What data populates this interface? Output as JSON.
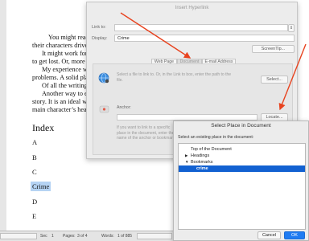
{
  "document": {
    "paragraphs": [
      "You might read th",
      "their characters drive",
      "It might work for",
      "to get lost. Or, more p",
      "My experience wa",
      "problems. A solid plan",
      "Of all the writing t",
      "Another way to ex",
      "story. It is an ideal wa",
      "main character’s head"
    ],
    "index_heading": "Index",
    "index_letters": [
      "A",
      "B",
      "C",
      "Crime",
      "D",
      "E"
    ]
  },
  "status_bar": {
    "section_label": "Sec",
    "section_value": "1",
    "pages_label": "Pages:",
    "pages_value": "3 of 4",
    "words_label": "Words:",
    "words_value": "1 of 885"
  },
  "hyperlink_dialog": {
    "title": "Insert Hyperlink",
    "link_to_label": "Link to:",
    "link_to_value": "",
    "display_label": "Display:",
    "display_value": "Crime",
    "screentip_button": "ScreenTip...",
    "tabs": [
      "Web Page",
      "Document",
      "E-mail Address"
    ],
    "file_hint": "Select a file to link to. Or, in the Link to box, enter the path to the file.",
    "select_button": "Select...",
    "anchor_label": "Anchor:",
    "anchor_value": "",
    "locate_button": "Locate...",
    "anchor_hint": "If you want to link to a specific place in the document, enter the name of the anchor or bookmark."
  },
  "place_dialog": {
    "title": "Select Place in Document",
    "prompt": "Select an existing place in the document:",
    "items": [
      {
        "label": "Top of the Document",
        "indent": 1,
        "toggle": "",
        "selected": false
      },
      {
        "label": "Headings",
        "indent": 1,
        "toggle": "▶",
        "selected": false
      },
      {
        "label": "Bookmarks",
        "indent": 1,
        "toggle": "▼",
        "selected": false
      },
      {
        "label": "crime",
        "indent": 2,
        "toggle": "",
        "selected": true
      }
    ],
    "cancel_button": "Cancel",
    "ok_button": "OK"
  },
  "colors": {
    "annotation_arrow": "#e8431f",
    "selection_blue": "#1261d1",
    "ok_blue": "#1f7bf2",
    "text_highlight": "#b5d3f3"
  }
}
